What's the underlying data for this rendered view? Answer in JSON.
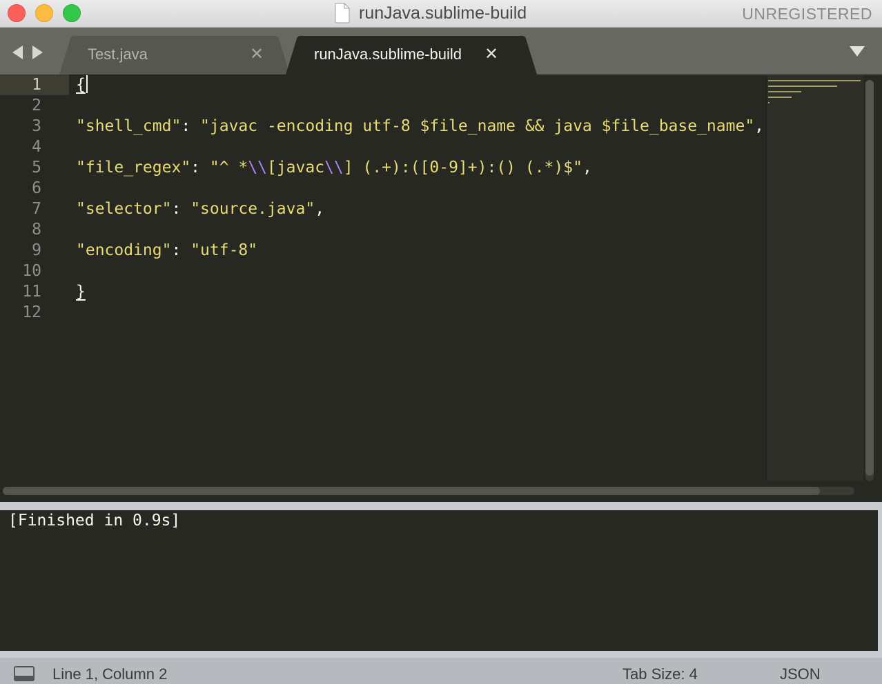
{
  "window": {
    "title": "runJava.sublime-build",
    "registration_status": "UNREGISTERED"
  },
  "tabs": [
    {
      "label": "Test.java",
      "close_glyph": "✕",
      "active": false
    },
    {
      "label": "runJava.sublime-build",
      "close_glyph": "✕",
      "active": true
    }
  ],
  "editor": {
    "line_numbers": [
      "1",
      "2",
      "3",
      "4",
      "5",
      "6",
      "7",
      "8",
      "9",
      "10",
      "11",
      "12"
    ],
    "current_line": 1,
    "lines": {
      "l1": "{",
      "l3_key": "\"shell_cmd\"",
      "l3_sep": ": ",
      "l3_val": "\"javac -encoding utf-8 $file_name && java $file_base_name\"",
      "l3_end": ",",
      "l5_key": "\"file_regex\"",
      "l5_sep": ": ",
      "l5_val_a": "\"^ *",
      "l5_esc_a": "\\\\",
      "l5_val_b": "[javac",
      "l5_esc_b": "\\\\",
      "l5_val_c": "] (.+):([0-9]+):() (.*)$\"",
      "l5_end": ",",
      "l7_key": "\"selector\"",
      "l7_sep": ": ",
      "l7_val": "\"source.java\"",
      "l7_end": ",",
      "l9_key": "\"encoding\"",
      "l9_sep": ": ",
      "l9_val": "\"utf-8\"",
      "l11": "}"
    }
  },
  "output_panel": {
    "text": "[Finished in 0.9s]"
  },
  "status_bar": {
    "position": "Line 1, Column 2",
    "tab_size": "Tab Size: 4",
    "syntax": "JSON"
  },
  "colors": {
    "editor_bg": "#272822",
    "string": "#e6db74",
    "escape": "#ae81ff",
    "text": "#f8f8f2",
    "line_number": "#90908a"
  }
}
